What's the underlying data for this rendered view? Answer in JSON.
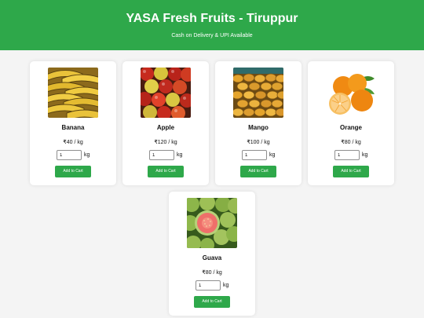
{
  "header": {
    "title": "YASA Fresh Fruits - Tiruppur",
    "subtitle": "Cash on Delivery & UPI Available",
    "bg_color": "#2ea84a"
  },
  "products": [
    {
      "name": "Banana",
      "price": "₹40 / kg",
      "qty": "1",
      "unit": "kg",
      "button": "Add to Cart",
      "image": "bananas-photo"
    },
    {
      "name": "Apple",
      "price": "₹120 / kg",
      "qty": "1",
      "unit": "kg",
      "button": "Add to Cart",
      "image": "apples-photo"
    },
    {
      "name": "Mango",
      "price": "₹100 / kg",
      "qty": "1",
      "unit": "kg",
      "button": "Add to Cart",
      "image": "mangoes-photo"
    },
    {
      "name": "Orange",
      "price": "₹80 / kg",
      "qty": "1",
      "unit": "kg",
      "button": "Add to Cart",
      "image": "oranges-photo"
    },
    {
      "name": "Guava",
      "price": "₹80 / kg",
      "qty": "1",
      "unit": "kg",
      "button": "Add to Cart",
      "image": "guavas-photo"
    }
  ]
}
